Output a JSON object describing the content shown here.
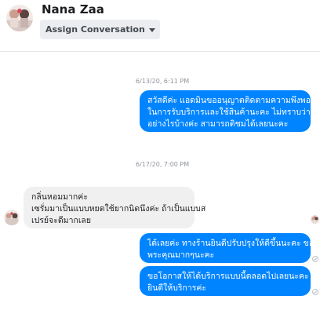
{
  "header": {
    "name": "Nana Zaa",
    "assign_label": "Assign Conversation"
  },
  "conversation": {
    "timestamp_1": "6/13/20, 6:11 PM",
    "timestamp_2": "6/17/20, 7:00 PM",
    "messages": [
      {
        "direction": "outgoing",
        "lines": [
          "สวัสดีค่ะ แอดมินขออนุญาตติดตามความพึงพอใจ",
          "ในการรับบริการและใช้สินค้านะคะ ไม่ทราบว่าเป็น",
          "อย่างไรบ้างค่ะ สามารถติชมได้เลยนะคะ"
        ]
      },
      {
        "direction": "incoming",
        "lines": [
          "กลิ่นหอมมากค่ะ",
          "เซรั่มมาเป็นแบบหยดใช้ยากนิดนึงค่ะ ถ้าเป็นแบบส",
          "เปรย์จะดีมากเลย"
        ]
      },
      {
        "direction": "outgoing",
        "lines": [
          "ได้เลยค่ะ ทางร้านยินดีปรับปรุงให้ดีขึ้นนะคะ ขอบ",
          "พระคุณมากๆนะคะ"
        ]
      },
      {
        "direction": "outgoing",
        "lines": [
          "ขอโอกาสให้ได้บริการแบบนี้ตลอดไปเลยนะคะ",
          "ยินดีให้บริการค่ะ"
        ]
      }
    ]
  },
  "icons": {
    "assign_caret": "caret-down-icon",
    "status": "delivered-check-icon"
  },
  "colors": {
    "outgoing_bubble": "#0084ff",
    "incoming_bubble": "#f1f0f0",
    "timestamp": "#90949c"
  }
}
